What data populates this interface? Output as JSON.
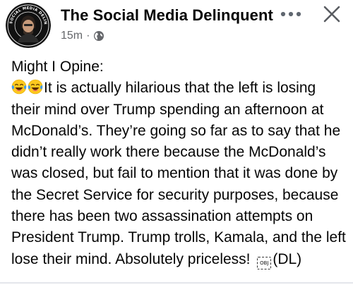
{
  "post": {
    "author": "The Social Media Delinquent",
    "avatar_text": "SOCIAL MEDIA DELINQUENT",
    "timestamp": "15m",
    "separator": "·",
    "audience_icon": "globe-icon",
    "heading": "Might I Opine:",
    "emojis": [
      "face-with-tears-of-joy",
      "face-with-tears-of-joy"
    ],
    "body": "It is actually hilarious that the left is losing their mind over Trump spending an afternoon at McDonald’s. They’re going so far as to say that he didn’t really work there because the McDonald’s was closed, but fail to mention that it was done by the Secret Service for security purposes, because there has been two assassination attempts on President Trump. Trump trolls, Kamala, and the left lose their mind. Absolutely priceless!",
    "object_glyph": "OBJ",
    "signature": "(DL)"
  },
  "controls": {
    "more_icon": "more-dots-icon",
    "close_icon": "close-icon"
  },
  "colors": {
    "text_primary": "#050505",
    "text_secondary": "#65676b",
    "emoji_face": "#fdc81e",
    "emoji_tear": "#3b9cf5",
    "divider": "#e4e6eb"
  }
}
